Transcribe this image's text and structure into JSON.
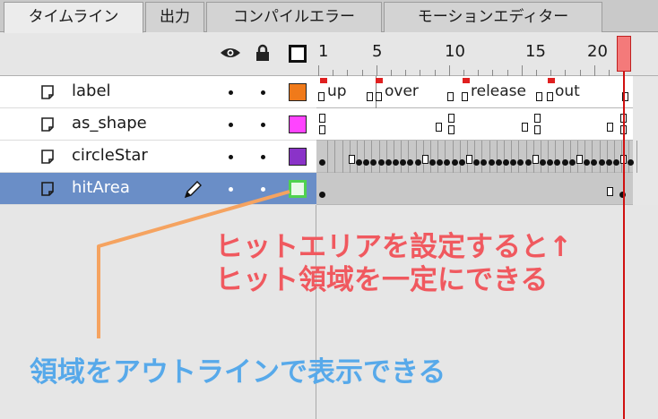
{
  "tabs": [
    {
      "label": "タイムライン",
      "active": true
    },
    {
      "label": "出力",
      "active": false
    },
    {
      "label": "コンパイルエラー",
      "active": false
    },
    {
      "label": "モーションエディター",
      "active": false
    }
  ],
  "header": {
    "icons": [
      "eye-icon",
      "lock-icon",
      "outline-icon"
    ],
    "ruler_numbers": [
      "1",
      "5",
      "10",
      "15",
      "20"
    ]
  },
  "layers": [
    {
      "name": "label",
      "color": "#f07a1a",
      "selected": false
    },
    {
      "name": "as_shape",
      "color": "#ff44ff",
      "selected": false
    },
    {
      "name": "circleStar",
      "color": "#8a33c8",
      "selected": false
    },
    {
      "name": "hitArea",
      "color": "#4fd24f",
      "selected": true
    }
  ],
  "frame_labels": [
    "up",
    "over",
    "release",
    "out"
  ],
  "annotations": {
    "red_line1": "ヒットエリアを設定すると↑",
    "red_line2": "ヒット領域を一定にできる",
    "blue": "領域をアウトラインで表示できる"
  },
  "colors": {
    "selection": "#6a8ec7",
    "playhead": "#d01010",
    "annotation_red": "#f0595f",
    "annotation_blue": "#57a9ea",
    "arrow": "#f5a360"
  }
}
